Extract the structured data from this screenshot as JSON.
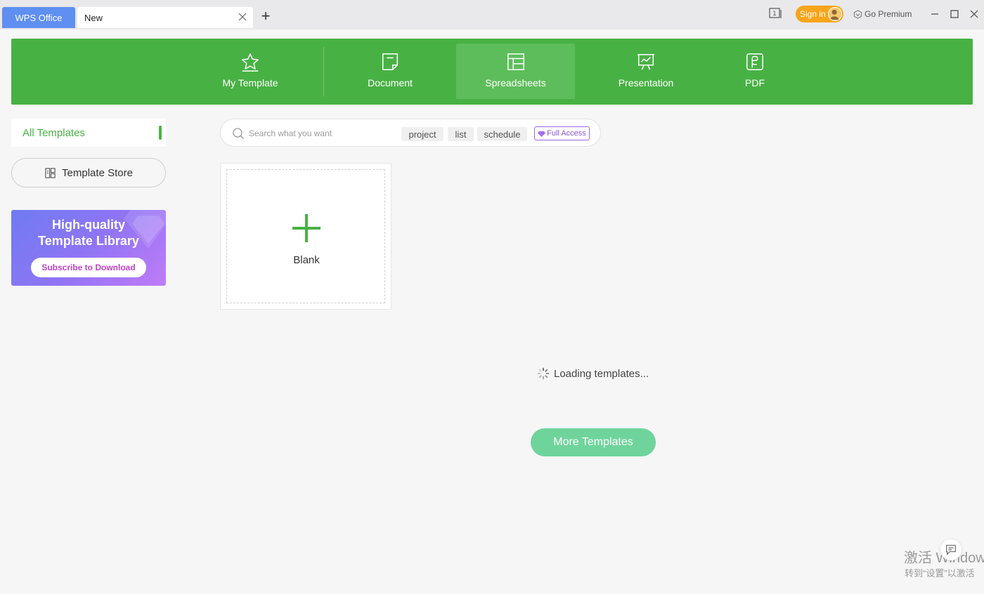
{
  "titlebar": {
    "app_tab": "WPS Office",
    "new_tab": "New",
    "window_count": "1",
    "sign_in": "Sign in",
    "go_premium": "Go Premium"
  },
  "nav": {
    "items": [
      {
        "label": "My Template",
        "icon": "star-icon"
      },
      {
        "label": "Document",
        "icon": "document-icon"
      },
      {
        "label": "Spreadsheets",
        "icon": "spreadsheet-icon",
        "active": true
      },
      {
        "label": "Presentation",
        "icon": "presentation-icon"
      },
      {
        "label": "PDF",
        "icon": "pdf-icon"
      }
    ]
  },
  "sidebar": {
    "all_templates": "All Templates",
    "template_store": "Template Store",
    "promo_title_line1": "High-quality",
    "promo_title_line2": "Template Library",
    "promo_button": "Subscribe to Download"
  },
  "search": {
    "placeholder": "Search what you want",
    "chips": [
      "project",
      "list",
      "schedule"
    ],
    "full_access": "Full Access"
  },
  "main": {
    "blank_label": "Blank",
    "loading_text": "Loading templates...",
    "more_button": "More Templates"
  },
  "activation": {
    "title": "激活 Windows",
    "subtitle": "转到“设置”以激活"
  },
  "colors": {
    "header_green": "#48b144",
    "app_tab_blue": "#5f8ff0",
    "sign_in_orange": "#f7a51b",
    "more_button_green": "#6fd49b"
  }
}
